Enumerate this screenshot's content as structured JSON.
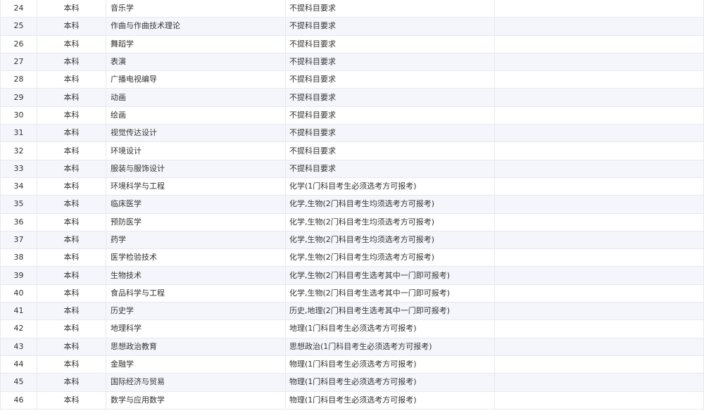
{
  "table": {
    "rows": [
      {
        "no": "24",
        "level": "本科",
        "major": "音乐学",
        "requirement": "不提科目要求"
      },
      {
        "no": "25",
        "level": "本科",
        "major": "作曲与作曲技术理论",
        "requirement": "不提科目要求"
      },
      {
        "no": "26",
        "level": "本科",
        "major": "舞蹈学",
        "requirement": "不提科目要求"
      },
      {
        "no": "27",
        "level": "本科",
        "major": "表演",
        "requirement": "不提科目要求"
      },
      {
        "no": "28",
        "level": "本科",
        "major": "广播电视编导",
        "requirement": "不提科目要求"
      },
      {
        "no": "29",
        "level": "本科",
        "major": "动画",
        "requirement": "不提科目要求"
      },
      {
        "no": "30",
        "level": "本科",
        "major": "绘画",
        "requirement": "不提科目要求"
      },
      {
        "no": "31",
        "level": "本科",
        "major": "视觉传达设计",
        "requirement": "不提科目要求"
      },
      {
        "no": "32",
        "level": "本科",
        "major": "环境设计",
        "requirement": "不提科目要求"
      },
      {
        "no": "33",
        "level": "本科",
        "major": "服装与服饰设计",
        "requirement": "不提科目要求"
      },
      {
        "no": "34",
        "level": "本科",
        "major": "环境科学与工程",
        "requirement": "化学(1门科目考生必须选考方可报考)"
      },
      {
        "no": "35",
        "level": "本科",
        "major": "临床医学",
        "requirement": "化学,生物(2门科目考生均须选考方可报考)"
      },
      {
        "no": "36",
        "level": "本科",
        "major": "预防医学",
        "requirement": "化学,生物(2门科目考生均须选考方可报考)"
      },
      {
        "no": "37",
        "level": "本科",
        "major": "药学",
        "requirement": "化学,生物(2门科目考生均须选考方可报考)"
      },
      {
        "no": "38",
        "level": "本科",
        "major": "医学检验技术",
        "requirement": "化学,生物(2门科目考生均须选考方可报考)"
      },
      {
        "no": "39",
        "level": "本科",
        "major": "生物技术",
        "requirement": "化学,生物(2门科目考生选考其中一门即可报考)"
      },
      {
        "no": "40",
        "level": "本科",
        "major": "食品科学与工程",
        "requirement": "化学,生物(2门科目考生选考其中一门即可报考)"
      },
      {
        "no": "41",
        "level": "本科",
        "major": "历史学",
        "requirement": "历史,地理(2门科目考生选考其中一门即可报考)"
      },
      {
        "no": "42",
        "level": "本科",
        "major": "地理科学",
        "requirement": "地理(1门科目考生必须选考方可报考)"
      },
      {
        "no": "43",
        "level": "本科",
        "major": "思想政治教育",
        "requirement": "思想政治(1门科目考生必须选考方可报考)"
      },
      {
        "no": "44",
        "level": "本科",
        "major": "金融学",
        "requirement": "物理(1门科目考生必须选考方可报考)"
      },
      {
        "no": "45",
        "level": "本科",
        "major": "国际经济与贸易",
        "requirement": "物理(1门科目考生必须选考方可报考)"
      },
      {
        "no": "46",
        "level": "本科",
        "major": "数学与应用数学",
        "requirement": "物理(1门科目考生必须选考方可报考)"
      }
    ]
  }
}
